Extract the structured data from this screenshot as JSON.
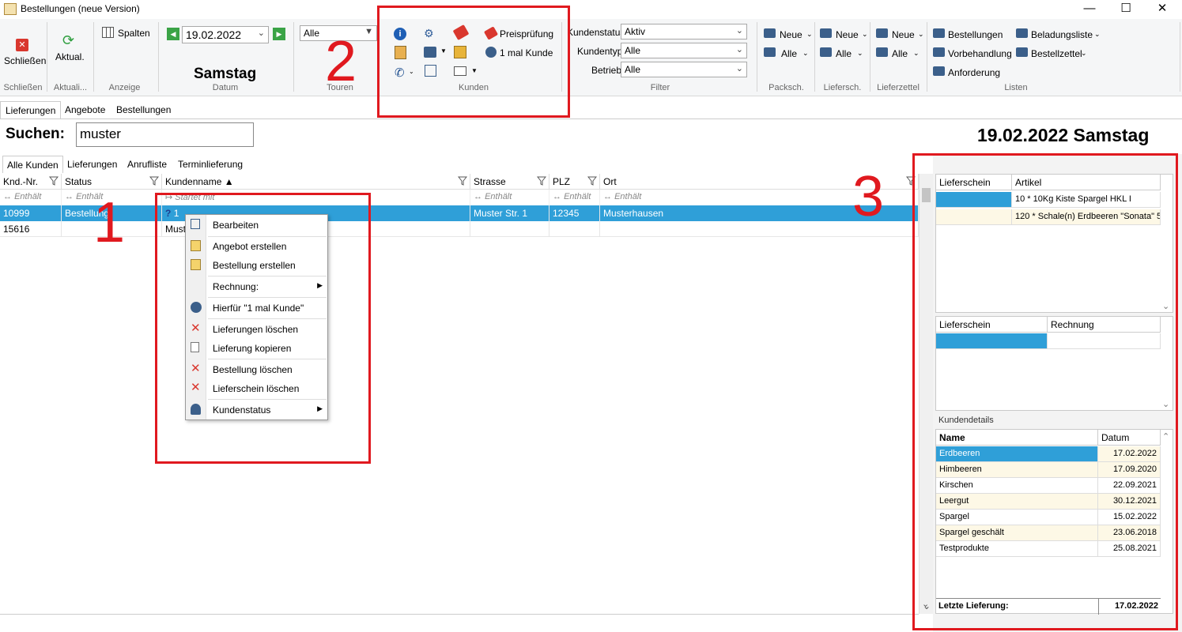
{
  "window": {
    "title": "Bestellungen (neue Version)"
  },
  "ribbon": {
    "close_label": "Schließen",
    "refresh_label": "Aktual.",
    "columns_label": "Spalten",
    "date_value": "19.02.2022",
    "weekday": "Samstag",
    "tours_value": "Alle",
    "price_check_label": "Preisprüfung",
    "one_time_customer_label": "1 mal Kunde",
    "filter_status_label": "Kundenstatus:",
    "filter_status_value": "Aktiv",
    "filter_type_label": "Kundentyp:",
    "filter_type_value": "Alle",
    "filter_plant_label": "Betrieb:",
    "filter_plant_value": "Alle",
    "new_label": "Neue",
    "all_label": "Alle",
    "list_orders": "Bestellungen",
    "list_prehandling": "Vorbehandlung",
    "list_request": "Anforderung",
    "list_loading": "Beladungsliste",
    "list_slip": "Bestellzettel",
    "groups": {
      "close": "Schließen",
      "refresh": "Aktuali...",
      "view": "Anzeige",
      "date": "Datum",
      "tours": "Touren",
      "customers": "Kunden",
      "filter": "Filter",
      "packing": "Packsch.",
      "delivery": "Liefersch.",
      "delivery_slip": "Lieferzettel",
      "lists": "Listen"
    }
  },
  "main_tabs": [
    "Lieferungen",
    "Angebote",
    "Bestellungen"
  ],
  "search": {
    "label": "Suchen:",
    "value": "muster"
  },
  "date_heading": "19.02.2022 Samstag",
  "sub_tabs": [
    "Alle Kunden",
    "Lieferungen",
    "Anrufliste",
    "Terminlieferung"
  ],
  "grid": {
    "columns": [
      "Knd.-Nr.",
      "Status",
      "Kundenname ▲",
      "Strasse",
      "PLZ",
      "Ort"
    ],
    "filter_contains": "Enthält",
    "filter_starts": "Startet mit",
    "rows": [
      {
        "nr": "10999",
        "status": "Bestellung:",
        "name": "1",
        "street": "Muster Str. 1",
        "zip": "12345",
        "city": "Musterhausen"
      },
      {
        "nr": "15616",
        "status": "",
        "name": "Must",
        "street": "",
        "zip": "",
        "city": ""
      }
    ]
  },
  "context_menu": {
    "items": [
      "Bearbeiten",
      "Angebot erstellen",
      "Bestellung erstellen",
      "Rechnung:",
      "Hierfür \"1 mal Kunde\"",
      "Lieferungen löschen",
      "Lieferung kopieren",
      "Bestellung löschen",
      "Lieferschein löschen",
      "Kundenstatus"
    ]
  },
  "annotations": {
    "one": "1",
    "two": "2",
    "three": "3"
  },
  "right_panel": {
    "top_grid": {
      "columns": [
        "Lieferschein",
        "Artikel"
      ],
      "rows": [
        {
          "slip": "",
          "article": "10 * 10Kg Kiste Spargel HKL I"
        },
        {
          "slip": "",
          "article": "120 * Schale(n) Erdbeeren \"Sonata\" 5"
        }
      ]
    },
    "mid_grid": {
      "columns": [
        "Lieferschein",
        "Rechnung"
      ]
    },
    "details_label": "Kundendetails",
    "details_grid": {
      "columns": [
        "Name",
        "Datum"
      ],
      "rows": [
        {
          "name": "Erdbeeren",
          "date": "17.02.2022"
        },
        {
          "name": "Himbeeren",
          "date": "17.09.2020"
        },
        {
          "name": "Kirschen",
          "date": "22.09.2021"
        },
        {
          "name": "Leergut",
          "date": "30.12.2021"
        },
        {
          "name": "Spargel",
          "date": "15.02.2022"
        },
        {
          "name": "Spargel geschält",
          "date": "23.06.2018"
        },
        {
          "name": "Testprodukte",
          "date": "25.08.2021"
        }
      ],
      "footer_label": "Letzte Lieferung:",
      "footer_value": "17.02.2022"
    }
  },
  "colors": {
    "selection": "#2f9fd8",
    "annotation_red": "#e0191f",
    "ribbon_bg": "#f5f6f7",
    "row_alt": "#fdf8e6"
  }
}
